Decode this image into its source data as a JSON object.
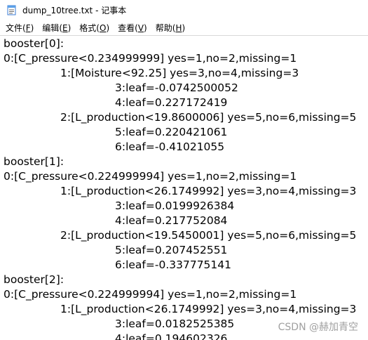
{
  "window": {
    "title": "dump_10tree.txt - 记事本",
    "icon": "notepad-icon"
  },
  "menu": [
    {
      "label": "文件",
      "key": "F"
    },
    {
      "label": "编辑",
      "key": "E"
    },
    {
      "label": "格式",
      "key": "O"
    },
    {
      "label": "查看",
      "key": "V"
    },
    {
      "label": "帮助",
      "key": "H"
    }
  ],
  "lines": [
    {
      "indent": 0,
      "text": "booster[0]:"
    },
    {
      "indent": 0,
      "text": "0:[C_pressure<0.234999999] yes=1,no=2,missing=1"
    },
    {
      "indent": 1,
      "text": "1:[Moisture<92.25] yes=3,no=4,missing=3"
    },
    {
      "indent": 2,
      "text": "3:leaf=-0.0742500052"
    },
    {
      "indent": 2,
      "text": "4:leaf=0.227172419"
    },
    {
      "indent": 1,
      "text": "2:[L_production<19.8600006] yes=5,no=6,missing=5"
    },
    {
      "indent": 2,
      "text": "5:leaf=0.220421061"
    },
    {
      "indent": 2,
      "text": "6:leaf=-0.41021055"
    },
    {
      "indent": 0,
      "text": "booster[1]:"
    },
    {
      "indent": 0,
      "text": "0:[C_pressure<0.224999994] yes=1,no=2,missing=1"
    },
    {
      "indent": 1,
      "text": "1:[L_production<26.1749992] yes=3,no=4,missing=3"
    },
    {
      "indent": 2,
      "text": "3:leaf=0.0199926384"
    },
    {
      "indent": 2,
      "text": "4:leaf=0.217752084"
    },
    {
      "indent": 1,
      "text": "2:[L_production<19.5450001] yes=5,no=6,missing=5"
    },
    {
      "indent": 2,
      "text": "5:leaf=0.207452551"
    },
    {
      "indent": 2,
      "text": "6:leaf=-0.337775141"
    },
    {
      "indent": 0,
      "text": "booster[2]:"
    },
    {
      "indent": 0,
      "text": "0:[C_pressure<0.224999994] yes=1,no=2,missing=1"
    },
    {
      "indent": 1,
      "text": "1:[L_production<26.1749992] yes=3,no=4,missing=3"
    },
    {
      "indent": 2,
      "text": "3:leaf=0.0182525385"
    },
    {
      "indent": 2,
      "text": "4:leaf=0.194602326"
    }
  ],
  "watermark": "CSDN @赫加青空"
}
